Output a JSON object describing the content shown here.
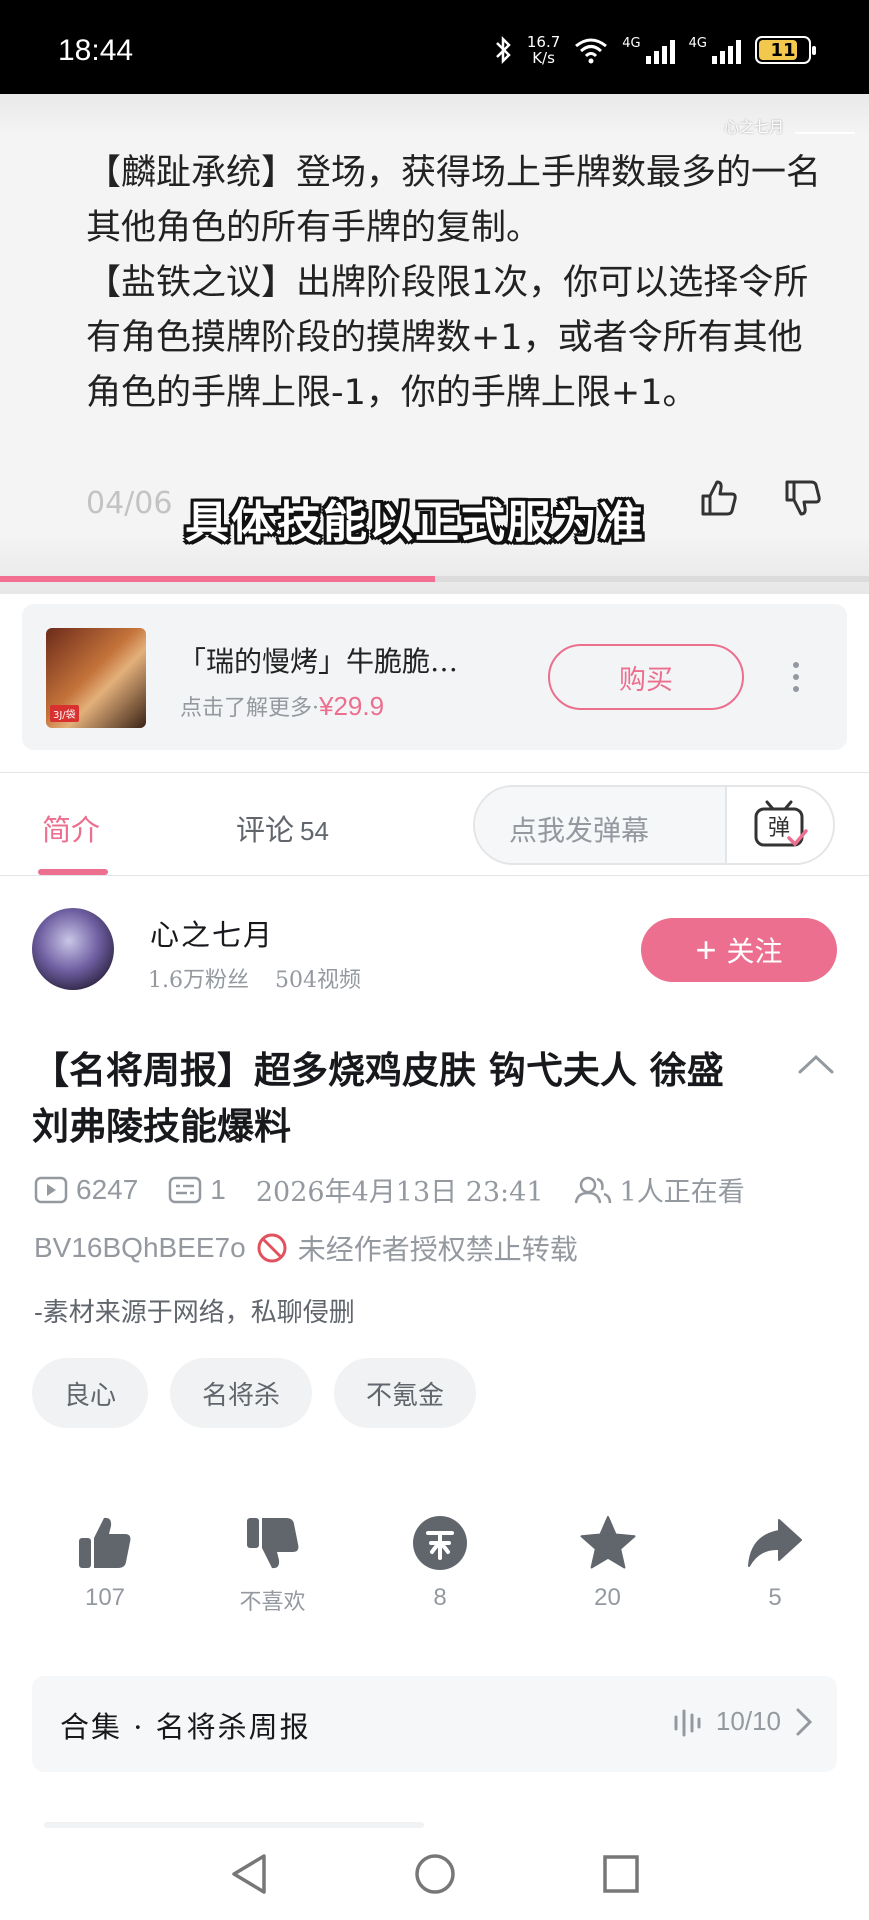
{
  "status_bar": {
    "time": "18:44",
    "net_speed_value": "16.7",
    "net_speed_unit": "K/s",
    "signal1_label": "4G",
    "signal2_label": "4G",
    "battery": "11",
    "icons": [
      "bluetooth-icon",
      "wifi-icon",
      "signal-icon",
      "battery-icon"
    ]
  },
  "video": {
    "watermark": "心之七月",
    "body_text": "【麟趾承统】登场，获得场上手牌数最多的一名其他角色的所有手牌的复制。\n【盐铁之议】出牌阶段限1次，你可以选择令所有角色摸牌阶段的摸牌数+1，或者令所有其他角色的手牌上限-1，你的手牌上限+1。",
    "date_partial": "04/06",
    "subtitle": "具体技能以正式服为准",
    "progress": 0.5
  },
  "ad": {
    "title": "「瑞的慢烤」牛脆脆…",
    "subtitle": "点击了解更多·",
    "price": "¥29.9",
    "buy_label": "购买",
    "thumb_tag": "3J/袋"
  },
  "tabs": {
    "intro": "简介",
    "comments": "评论",
    "comments_count": "54",
    "danmaku_placeholder": "点我发弹幕",
    "danmaku_icon_text": "弹"
  },
  "uploader": {
    "name": "心之七月",
    "fans": "1.6万粉丝",
    "videos": "504视频",
    "follow_label": "关注",
    "follow_plus": "+"
  },
  "video_info": {
    "title": "【名将周报】超多烧鸡皮肤 钩弋夫人 徐盛 刘弗陵技能爆料",
    "views": "6247",
    "danmaku_count": "1",
    "datetime": "2026年4月13日 23:41",
    "watching": "1人正在看",
    "bvid": "BV16BQhBEE7o",
    "copyright": "未经作者授权禁止转载",
    "description": "-素材来源于网络，私聊侵删"
  },
  "tags": [
    "良心",
    "名将杀",
    "不氪金"
  ],
  "actions": [
    {
      "icon": "thumbs-up-icon",
      "label": "107"
    },
    {
      "icon": "thumbs-down-icon",
      "label": "不喜欢"
    },
    {
      "icon": "coin-icon",
      "label": "8"
    },
    {
      "icon": "star-icon",
      "label": "20"
    },
    {
      "icon": "share-icon",
      "label": "5"
    }
  ],
  "collection": {
    "name": "合集 · 名将杀周报",
    "progress": "10/10"
  },
  "colors": {
    "accent": "#ec6f8f",
    "muted": "#9499a0",
    "text": "#18191c"
  }
}
